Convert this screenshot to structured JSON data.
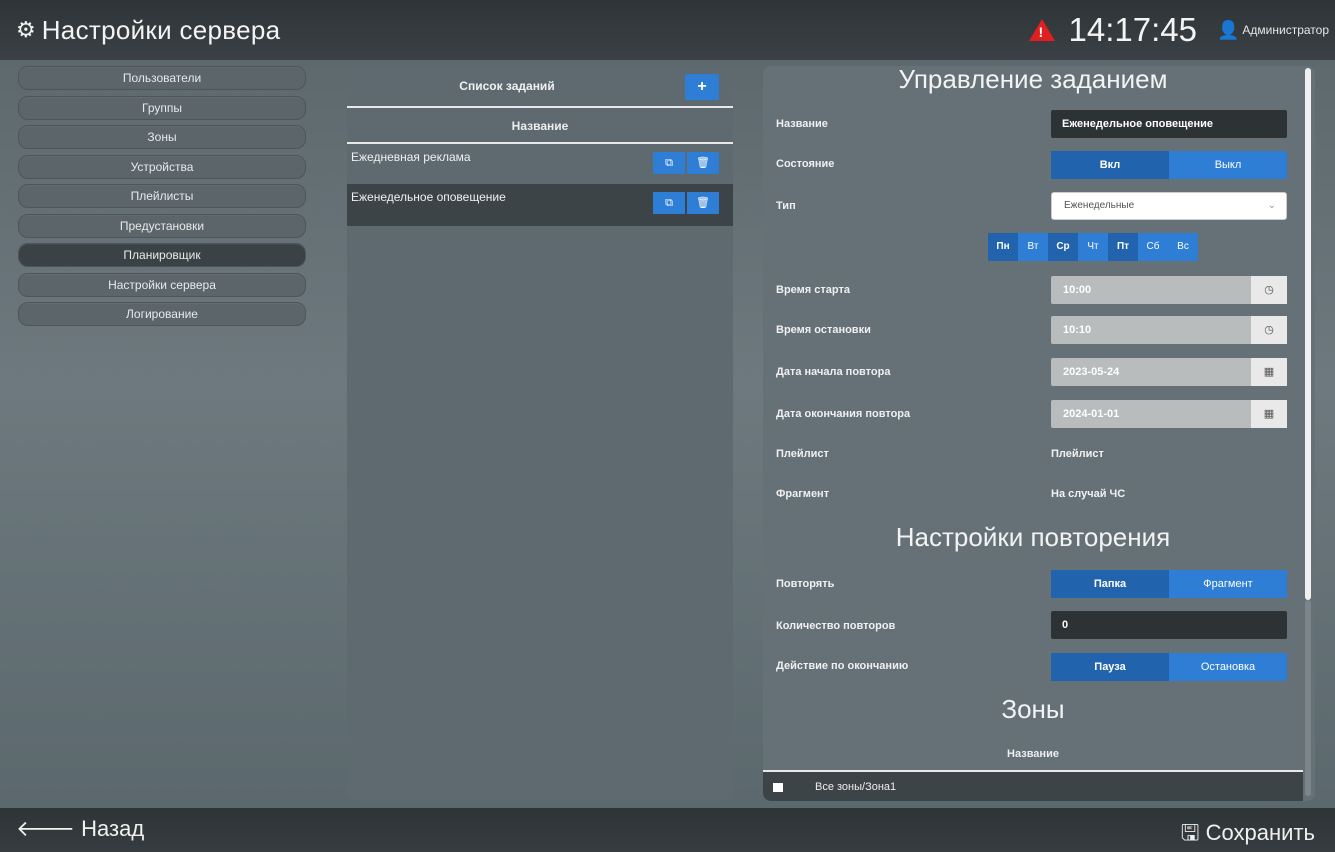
{
  "header": {
    "title": "Настройки сервера",
    "time": "14:17:45",
    "user": "Администратор",
    "warning_icon": "warning-icon",
    "gears_icon": "gears-icon",
    "user_icon": "user-icon"
  },
  "menu": {
    "items": [
      "Пользователи",
      "Группы",
      "Зоны",
      "Устройства",
      "Плейлисты",
      "Предустановки",
      "Планировщик",
      "Настройки сервера",
      "Логирование"
    ],
    "active": "Планировщик"
  },
  "tasks": {
    "title": "Список заданий",
    "add_label": "+",
    "column": "Название",
    "rows": [
      {
        "name": "Ежедневная реклама"
      },
      {
        "name": "Еженедельное оповещение"
      }
    ]
  },
  "job": {
    "title": "Управление заданием",
    "name_label": "Название",
    "name_value": "Еженедельное оповещение",
    "state_label": "Состояние",
    "state_on": "Вкл",
    "state_off": "Выкл",
    "type_label": "Тип",
    "type_value": "Еженедельные",
    "days": [
      "Пн",
      "Вт",
      "Ср",
      "Чт",
      "Пт",
      "Сб",
      "Вс"
    ],
    "days_selected": [
      true,
      false,
      true,
      false,
      true,
      false,
      false
    ],
    "start_label": "Время старта",
    "start_value": "10:00",
    "stop_label": "Время остановки",
    "stop_value": "10:10",
    "repeat_start_label": "Дата начала повтора",
    "repeat_start_value": "2023-05-24",
    "repeat_end_label": "Дата окончания повтора",
    "repeat_end_value": "2024-01-01",
    "playlist_label": "Плейлист",
    "playlist_value": "Плейлист",
    "fragment_label": "Фрагмент",
    "fragment_value": "На случай ЧС",
    "repeat_settings_title": "Настройки повторения",
    "repeat_label": "Повторять",
    "repeat_opt1": "Папка",
    "repeat_opt2": "Фрагмент",
    "repeat_count_label": "Количество повторов",
    "repeat_count_value": "0",
    "end_action_label": "Действие по окончанию",
    "end_action_opt1": "Пауза",
    "end_action_opt2": "Остановка",
    "zones_title": "Зоны",
    "zones_column": "Название",
    "zones": [
      "Все зоны/Зона1"
    ]
  },
  "footer": {
    "back_label": "Назад",
    "save_label": "Сохранить"
  },
  "colors": {
    "accent": "#2f7ed6",
    "accent_dark": "#2263ad",
    "warning": "#e02020"
  }
}
